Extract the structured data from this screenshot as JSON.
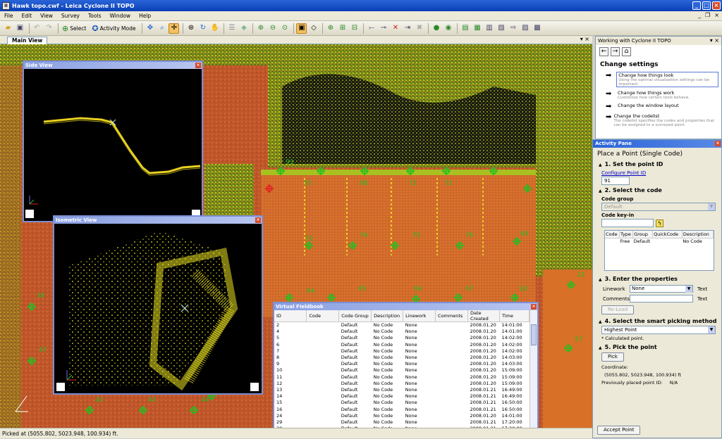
{
  "app": {
    "title": "Hawk topo.cwf - Leica Cyclone II TOPO",
    "icon_text": "II"
  },
  "menu": [
    "File",
    "Edit",
    "View",
    "Survey",
    "Tools",
    "Window",
    "Help"
  ],
  "toolbar": {
    "select_label": "Select",
    "activity_mode_label": "Activity Mode"
  },
  "tabs": {
    "main": "Main View"
  },
  "side_view": {
    "title": "Side View"
  },
  "iso_view": {
    "title": "Isometric View"
  },
  "map_labels": [
    "93",
    "70",
    "68",
    "71",
    "73",
    "72",
    "74",
    "75",
    "76",
    "69",
    "64",
    "65",
    "66",
    "67",
    "62",
    "57",
    "58",
    "47",
    "42",
    "43",
    "44",
    "12"
  ],
  "fieldbook": {
    "title": "Virtual Fieldbook",
    "columns": [
      "ID",
      "Code",
      "Code Group",
      "Description",
      "Linework",
      "Comments",
      "Date Created",
      "Time"
    ],
    "rows": [
      [
        "2",
        "",
        "Default",
        "No Code",
        "None",
        "",
        "2008.01.20",
        "14:01:00"
      ],
      [
        "4",
        "",
        "Default",
        "No Code",
        "None",
        "",
        "2008.01.20",
        "14:01:00"
      ],
      [
        "5",
        "",
        "Default",
        "No Code",
        "None",
        "",
        "2008.01.20",
        "14:02:00"
      ],
      [
        "6",
        "",
        "Default",
        "No Code",
        "None",
        "",
        "2008.01.20",
        "14:02:00"
      ],
      [
        "7",
        "",
        "Default",
        "No Code",
        "None",
        "",
        "2008.01.20",
        "14:02:00"
      ],
      [
        "8",
        "",
        "Default",
        "No Code",
        "None",
        "",
        "2008.01.20",
        "14:03:00"
      ],
      [
        "9",
        "",
        "Default",
        "No Code",
        "None",
        "",
        "2008.01.20",
        "14:03:00"
      ],
      [
        "10",
        "",
        "Default",
        "No Code",
        "None",
        "",
        "2008.01.20",
        "15:09:00"
      ],
      [
        "11",
        "",
        "Default",
        "No Code",
        "None",
        "",
        "2008.01.20",
        "15:09:00"
      ],
      [
        "12",
        "",
        "Default",
        "No Code",
        "None",
        "",
        "2008.01.20",
        "15:09:00"
      ],
      [
        "13",
        "",
        "Default",
        "No Code",
        "None",
        "",
        "2008.01.21",
        "16:49:00"
      ],
      [
        "14",
        "",
        "Default",
        "No Code",
        "None",
        "",
        "2008.01.21",
        "16:49:00"
      ],
      [
        "15",
        "",
        "Default",
        "No Code",
        "None",
        "",
        "2008.01.21",
        "16:50:00"
      ],
      [
        "16",
        "",
        "Default",
        "No Code",
        "None",
        "",
        "2008.01.21",
        "16:50:00"
      ],
      [
        "24",
        "",
        "Default",
        "No Code",
        "None",
        "",
        "2008.01.20",
        "14:01:00"
      ],
      [
        "29",
        "",
        "Default",
        "No Code",
        "None",
        "",
        "2008.01.21",
        "17:20:00"
      ],
      [
        "30",
        "",
        "Default",
        "No Code",
        "None",
        "",
        "2008.01.21",
        "17:20:00"
      ]
    ]
  },
  "status": {
    "text": "Picked at (5055.802, 5023.948, 100.934) ft."
  },
  "help": {
    "header": "Working with Cyclone II TOPO",
    "title": "Change settings",
    "items": [
      {
        "title": "Change how things look",
        "desc": "Using the optimal visualization settings can be important."
      },
      {
        "title": "Change how things work",
        "desc": "Customize how certain tools behave."
      },
      {
        "title": "Change the window layout",
        "desc": ""
      },
      {
        "title": "Change the codelist",
        "desc": "The codelist specifies the codes and properties that can be assigned to a surveyed point."
      }
    ]
  },
  "activity": {
    "header": "Activity Pane",
    "title": "Place a Point (Single Code)",
    "step1": "1. Set the point ID",
    "configure_link": "Configure Point ID",
    "point_id": "91",
    "step2": "2. Select the code",
    "code_group_label": "Code group",
    "code_group_value": "Default",
    "code_keyin_label": "Code key-in",
    "code_keyin_value": "",
    "code_columns": [
      "Code",
      "Type",
      "Group",
      "QuickCode",
      "Description"
    ],
    "code_row": [
      "",
      "Free",
      "Default",
      "",
      "No Code"
    ],
    "step3": "3. Enter the properties",
    "linework_label": "Linework",
    "linework_value": "None",
    "linework_text": "Text",
    "comments_label": "Comments",
    "comments_value": "",
    "comments_text": "Text",
    "reload_label": "Re-Load",
    "step4": "4. Select the smart picking method",
    "picking_value": "Highest Point",
    "calc_note": "* Calculated point.",
    "step5": "5. Pick the point",
    "pick_label": "Pick",
    "coordinate_label": "Coordinate:",
    "coordinate_value": "(5055.802, 5023.948, 100.934) ft",
    "prev_label": "Previously placed point ID:",
    "prev_value": "N/A",
    "accept_label": "Accept Point"
  }
}
